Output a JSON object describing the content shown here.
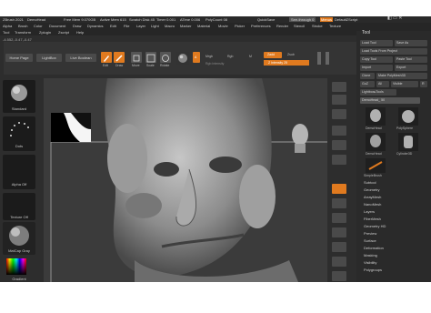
{
  "titlebar": {
    "app": "ZBrush 2021",
    "document": "DemoHead",
    "memory": "Free Mem 9.070GB",
    "active_mem": "Active Mem 615",
    "scratch": "Scratch Disk 45",
    "timer": "Timer 0.001",
    "atime": "ATime 0.006",
    "polycount": "PolyCount 08",
    "quicksave": "QuickSave",
    "see_through": "See-through 0",
    "menus_toggle": "Menus",
    "script": "DefaultZScript"
  },
  "menus": [
    "Alpha",
    "Brush",
    "Color",
    "Document",
    "Draw",
    "Dynamics",
    "Edit",
    "File",
    "Layer",
    "Light",
    "Macro",
    "Marker",
    "Material",
    "Movie",
    "Picker",
    "Preferences",
    "Render",
    "Stencil",
    "Stroke",
    "Texture"
  ],
  "submenus": [
    "Tool",
    "Transform",
    "Zplugin",
    "Zscript",
    "Help"
  ],
  "info_coords": "-4.552,-0.47,-0.47",
  "shelf": {
    "home_page": "Home Page",
    "lightbox": "LightBox",
    "live_boolean": "Live Boolean",
    "edit": "Edit",
    "draw": "Draw",
    "move": "Move",
    "scale": "Scale",
    "rotate": "Rotate",
    "a_label": "A",
    "mrgb": "Mrgb",
    "rgb": "Rgb",
    "m": "M",
    "zadd": "Zadd",
    "zsub": "Zsub",
    "z_intensity": "Z Intensity 25",
    "rgb_intensity": "Rgb Intensity"
  },
  "left": {
    "standard": "Standard",
    "dots": "Dots",
    "alpha_off": "Alpha Off",
    "texture_off": "Texture Off",
    "matcap": "MatCap Gray",
    "gradient": "Gradient"
  },
  "tool": {
    "title": "Tool",
    "load_tool": "Load Tool",
    "save_as": "Save As",
    "load_from_project": "Load Tools From Project",
    "copy_tool": "Copy Tool",
    "paste_tool": "Paste Tool",
    "import": "Import",
    "export": "Export",
    "clone": "Clone",
    "make_polymesh": "Make PolyMesh3D",
    "goz": "GoZ",
    "all": "All",
    "visible": "Visible",
    "r": "R",
    "lightbox_tools": "Lightbox▸Tools",
    "demohead_value": "DemoHead_ 50",
    "thumb1": "DemoHead",
    "thumb2": "PolySphere",
    "thumb3": "DemoHead",
    "thumb4": "Cylinder3D",
    "thumb5": "SimpleBrush",
    "sections": [
      "Subtool",
      "Geometry",
      "ArrayMesh",
      "NanoMesh",
      "Layers",
      "FiberMesh",
      "Geometry HD",
      "Preview",
      "Surface",
      "Deformation",
      "Masking",
      "Visibility",
      "Polygroups"
    ]
  },
  "colors": {
    "accent": "#e07a1f",
    "ui_bg": "#2d2d2d"
  }
}
